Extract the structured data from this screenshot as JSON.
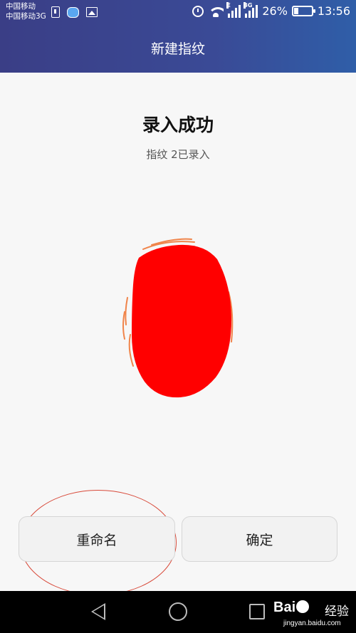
{
  "status_bar": {
    "carrier_1": "中国移动",
    "carrier_2": "中国移动3G",
    "net_type_1": "E",
    "net_type_2": "3G",
    "battery": "26%",
    "battery_level": 0.26,
    "time": "13:56",
    "icons": [
      "usb-icon",
      "message-bubble-icon",
      "image-icon",
      "alarm-icon",
      "wifi-icon",
      "signal-icon",
      "signal-icon",
      "battery-icon"
    ]
  },
  "title_bar": {
    "title": "新建指纹"
  },
  "main": {
    "headline": "录入成功",
    "subline": "指纹 2已录入"
  },
  "buttons": {
    "rename": "重命名",
    "confirm": "确定"
  },
  "nav_bar": {
    "icons": [
      "back-icon",
      "home-icon",
      "recent-apps-icon"
    ]
  },
  "watermark": {
    "logo": "Bai du",
    "text": "经验",
    "url": "jingyan.baidu.com"
  },
  "colors": {
    "header_start": "#3a3e86",
    "header_end": "#2f5ea8",
    "redaction": "#ff0000",
    "annotation": "#d84a3a"
  }
}
